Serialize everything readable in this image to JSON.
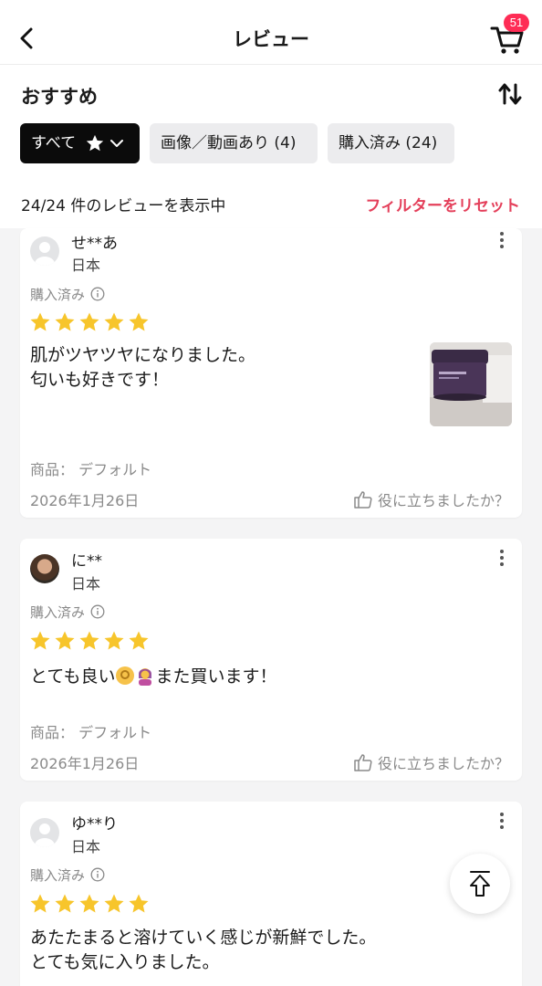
{
  "header": {
    "title": "レビュー",
    "cart_count": "51"
  },
  "section": {
    "title": "おすすめ"
  },
  "filters": [
    {
      "label": "すべて"
    },
    {
      "label": "画像／動画あり (4)"
    },
    {
      "label": "購入済み (24)"
    }
  ],
  "summary": {
    "count_text": "24/24 件のレビューを表示中",
    "reset_label": "フィルターをリセット"
  },
  "reviews": [
    {
      "user": "せ**あ",
      "country": "日本",
      "purchased": "購入済み",
      "rating": 5,
      "text": "肌がツヤツヤになりました。\n匂いも好きです！",
      "product": "商品： デフォルト",
      "date": "2026年1月26日",
      "helpful": "役に立ちましたか？"
    },
    {
      "user": "に**",
      "country": "日本",
      "purchased": "購入済み",
      "rating": 5,
      "text_before": "とても良い",
      "text_after": "また買います！",
      "product": "商品： デフォルト",
      "date": "2026年1月26日",
      "helpful": "役に立ちましたか？"
    },
    {
      "user": "ゆ**り",
      "country": "日本",
      "purchased": "購入済み",
      "rating": 5,
      "text": "あたたまると溶けていく感じが新鮮でした。\nとても気に入りました。"
    }
  ],
  "colors": {
    "accent": "#fe2c55",
    "reset": "#e43f5a",
    "star": "#f7c52b"
  },
  "icons": [
    "back-arrow-icon",
    "cart-icon",
    "sort-icon",
    "star-icon",
    "chevron-down-icon",
    "info-icon",
    "more-vertical-icon",
    "thumbs-up-icon",
    "scroll-to-top-icon"
  ]
}
